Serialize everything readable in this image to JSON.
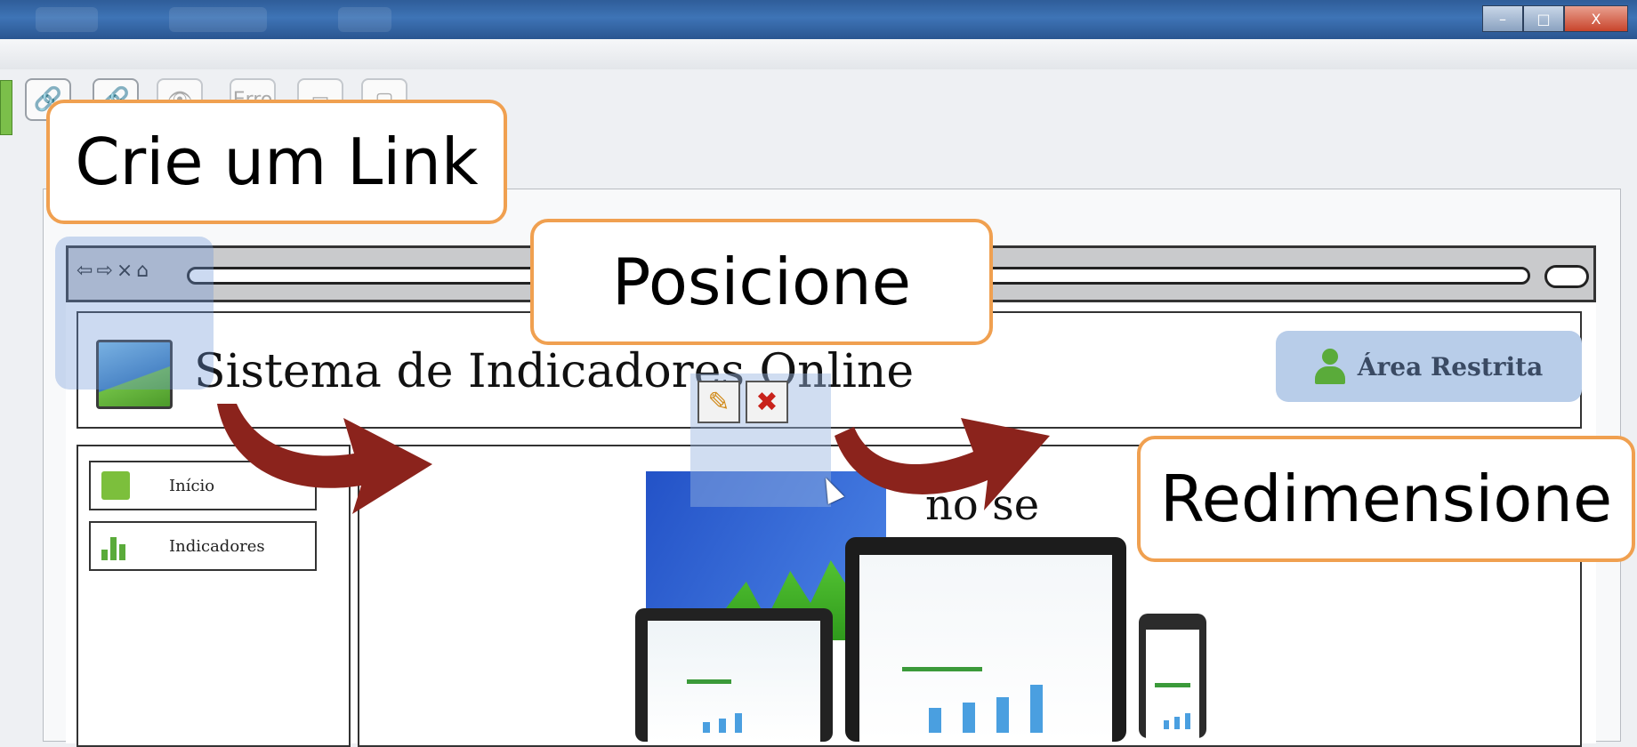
{
  "window": {
    "controls": [
      "–",
      "□",
      "X"
    ]
  },
  "toolbar": {
    "error_button": "Erro"
  },
  "mockup": {
    "site_title": "Sistema de Indicadores Online",
    "restricted_area": "Área Restrita",
    "nav_icons": "⇦⇨×⌂",
    "sidebar": [
      {
        "label": "Início",
        "icon": "home-icon"
      },
      {
        "label": "Indicadores",
        "icon": "bar-chart-icon"
      }
    ],
    "main_text_fragment": "no se"
  },
  "callouts": {
    "create_link": "Crie um Link",
    "position": "Posicione",
    "resize": "Redimensione"
  },
  "colors": {
    "callout_border": "#f0a050",
    "arrow": "#8b231c",
    "overlay": "#6e96d7"
  }
}
